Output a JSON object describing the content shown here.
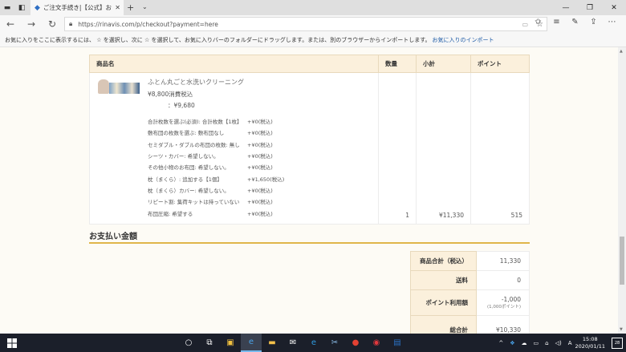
{
  "browser": {
    "tab_title": "ご注文手続き|【公式】お",
    "url": "https://rinavis.com/p/checkout?payment=here",
    "favbar_text": "お気に入りをここに表示するには、 ☆ を選択し、次に ☆ を選択して、お気に入りバーのフォルダーにドラッグします。または、別のブラウザーからインポートします。",
    "favbar_link": "お気に入りのインポート"
  },
  "cart": {
    "headers": {
      "name": "商品名",
      "qty": "数量",
      "subtotal": "小計",
      "points": "ポイント"
    },
    "product": {
      "name": "ふとん丸ごと水洗いクリーニング",
      "price_line1": "¥8,800消費税込",
      "price_line2": "：¥9,680",
      "options": [
        {
          "key": "合計枚数を選ぶ(必須): 合計枚数【1枚】",
          "val": "+¥0(税込)"
        },
        {
          "key": "敷布団の枚数を選ぶ: 敷布団なし",
          "val": "+¥0(税込)"
        },
        {
          "key": "セミダブル・ダブルの布団の枚数: 無し",
          "val": "+¥0(税込)"
        },
        {
          "key": "シーツ・カバー: 希望しない。",
          "val": "+¥0(税込)"
        },
        {
          "key": "その他小物のお布団: 希望しない。",
          "val": "+¥0(税込)"
        },
        {
          "key": "枕（まくら）: 追加する【1個】",
          "val": "+¥1,650(税込)"
        },
        {
          "key": "枕（まくら）カバー: 希望しない。",
          "val": "+¥0(税込)"
        },
        {
          "key": "リピート割: 集荷キットは持っていない",
          "val": "+¥0(税込)"
        },
        {
          "key": "布団圧縮: 希望する",
          "val": "+¥0(税込)"
        }
      ],
      "qty": "1",
      "subtotal": "¥11,330",
      "points": "515"
    }
  },
  "payment": {
    "title": "お支払い金額",
    "rows": {
      "goods_label": "商品合計（税込）",
      "goods_value": "11,330",
      "shipping_label": "送料",
      "shipping_value": "0",
      "points_label": "ポイント利用額",
      "points_value": "-1,000",
      "points_note": "(1,000ポイント)",
      "total_label": "総合計",
      "total_value": "¥10,330"
    }
  },
  "taskbar": {
    "time": "15:08",
    "date": "2020/01/11",
    "notifications": "28"
  }
}
